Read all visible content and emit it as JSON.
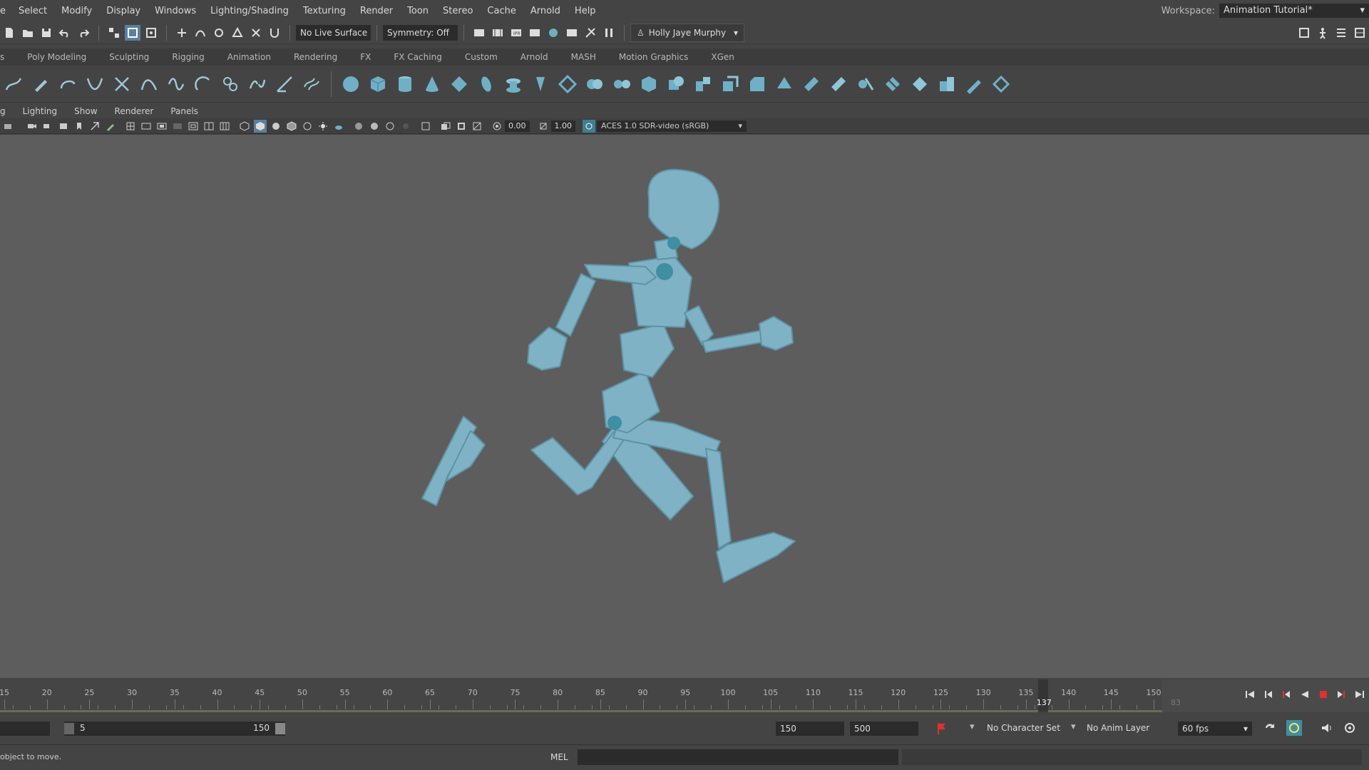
{
  "menu": [
    "e",
    "Select",
    "Modify",
    "Display",
    "Windows",
    "Lighting/Shading",
    "Texturing",
    "Render",
    "Toon",
    "Stereo",
    "Cache",
    "Arnold",
    "Help"
  ],
  "workspace": {
    "label": "Workspace:",
    "value": "Animation Tutorial*"
  },
  "status_line": {
    "live_surface": "No Live Surface",
    "symmetry": "Symmetry: Off",
    "user": "Holly Jaye Murphy"
  },
  "shelf_tabs": [
    "s",
    "Poly Modeling",
    "Sculpting",
    "Rigging",
    "Animation",
    "Rendering",
    "FX",
    "FX Caching",
    "Custom",
    "Arnold",
    "MASH",
    "Motion Graphics",
    "XGen"
  ],
  "panel_menu": [
    "g",
    "Lighting",
    "Show",
    "Renderer",
    "Panels"
  ],
  "panel_toolbar": {
    "exposure": "0.00",
    "gamma": "1.00",
    "color_space": "ACES 1.0 SDR-video (sRGB)"
  },
  "timeline": {
    "ticks": [
      "15",
      "20",
      "25",
      "30",
      "35",
      "40",
      "45",
      "50",
      "55",
      "60",
      "65",
      "70",
      "75",
      "80",
      "85",
      "90",
      "95",
      "100",
      "105",
      "110",
      "115",
      "120",
      "125",
      "130",
      "135",
      "140",
      "145",
      "150"
    ],
    "visible_start": 15,
    "visible_end": 150,
    "current_frame": "137",
    "current_frame_value": 137,
    "faded_label": "83"
  },
  "range": {
    "start": "5",
    "end": "150",
    "anim_end": "150",
    "max_end": "500",
    "character_set": "No Character Set",
    "anim_layer": "No Anim Layer",
    "fps": "60 fps"
  },
  "command_line": {
    "help_text": "object to move.",
    "language": "MEL"
  },
  "colors": {
    "viewport_bg": "#5d5d5d",
    "character_body": "#7fb2c4",
    "joint": "#3f8fa3",
    "accent_red": "#e03030"
  }
}
